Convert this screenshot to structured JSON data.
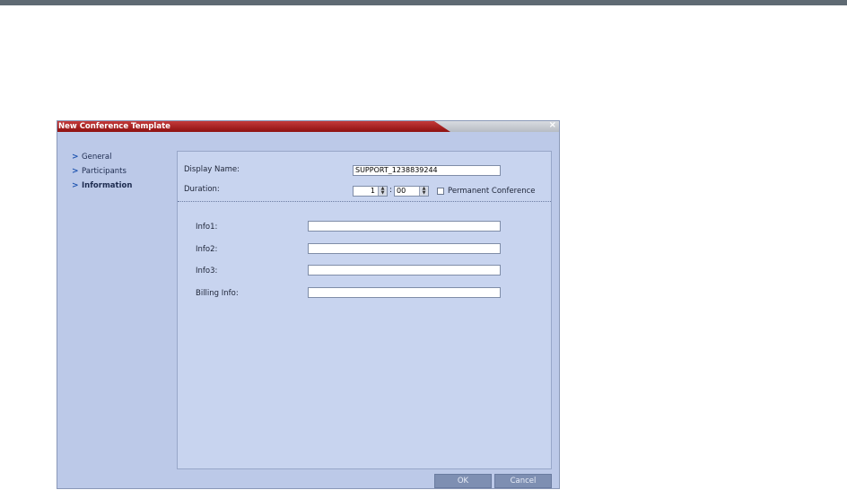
{
  "dialog": {
    "title": "New Conference Template",
    "nav": [
      {
        "label": "General",
        "active": false
      },
      {
        "label": "Participants",
        "active": false
      },
      {
        "label": "Information",
        "active": true
      }
    ],
    "display_name": {
      "label": "Display Name:",
      "value": "SUPPORT_1238839244"
    },
    "duration": {
      "label": "Duration:",
      "hours": "1",
      "separator": ":",
      "minutes": "00"
    },
    "permanent": {
      "label": "Permanent Conference",
      "checked": false
    },
    "fields": [
      {
        "label": "Info1:",
        "value": ""
      },
      {
        "label": "Info2:",
        "value": ""
      },
      {
        "label": "Info3:",
        "value": ""
      },
      {
        "label": "Billing Info:",
        "value": ""
      }
    ],
    "buttons": {
      "ok": "OK",
      "cancel": "Cancel"
    }
  }
}
